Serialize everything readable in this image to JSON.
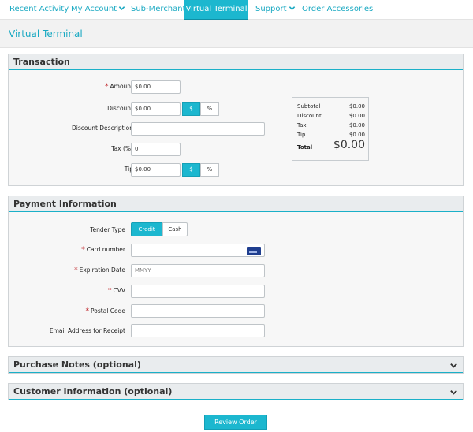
{
  "nav": {
    "items": [
      {
        "label": "Recent Activity"
      },
      {
        "label": "My Account"
      },
      {
        "label": "Sub-Merchants"
      },
      {
        "label": "Virtual Terminal"
      },
      {
        "label": "Support"
      },
      {
        "label": "Order Accessories"
      }
    ],
    "active": "Virtual Terminal"
  },
  "page": {
    "title": "Virtual Terminal"
  },
  "transaction": {
    "title": "Transaction",
    "amount_label": "Amount",
    "amount_value": "$0.00",
    "discount_label": "Discount",
    "discount_value": "$0.00",
    "discount_dollar": "$",
    "discount_percent": "%",
    "discount_desc_label": "Discount Description",
    "discount_desc_value": "",
    "tax_label": "Tax (%)",
    "tax_value": "0",
    "tip_label": "Tip",
    "tip_value": "$0.00",
    "tip_dollar": "$",
    "tip_percent": "%"
  },
  "summary": {
    "subtotal_label": "Subtotal",
    "subtotal_value": "$0.00",
    "discount_label": "Discount",
    "discount_value": "$0.00",
    "tax_label": "Tax",
    "tax_value": "$0.00",
    "tip_label": "Tip",
    "tip_value": "$0.00",
    "total_label": "Total",
    "total_value": "$0.00"
  },
  "payment": {
    "title": "Payment Information",
    "tender_label": "Tender Type",
    "tender_credit": "Credit",
    "tender_cash": "Cash",
    "card_label": "Card number",
    "card_value": "",
    "exp_label": "Expiration Date",
    "exp_placeholder": "MMYY",
    "cvv_label": "CVV",
    "cvv_value": "",
    "postal_label": "Postal Code",
    "postal_value": "",
    "email_label": "Email Address for Receipt",
    "email_value": ""
  },
  "purchase_notes": {
    "title": "Purchase Notes (optional)"
  },
  "customer_info": {
    "title": "Customer Information (optional)"
  },
  "actions": {
    "review_label": "Review Order"
  },
  "colors": {
    "accent": "#1cb7cf",
    "link": "#1aa9c2",
    "required": "#c0282d"
  }
}
